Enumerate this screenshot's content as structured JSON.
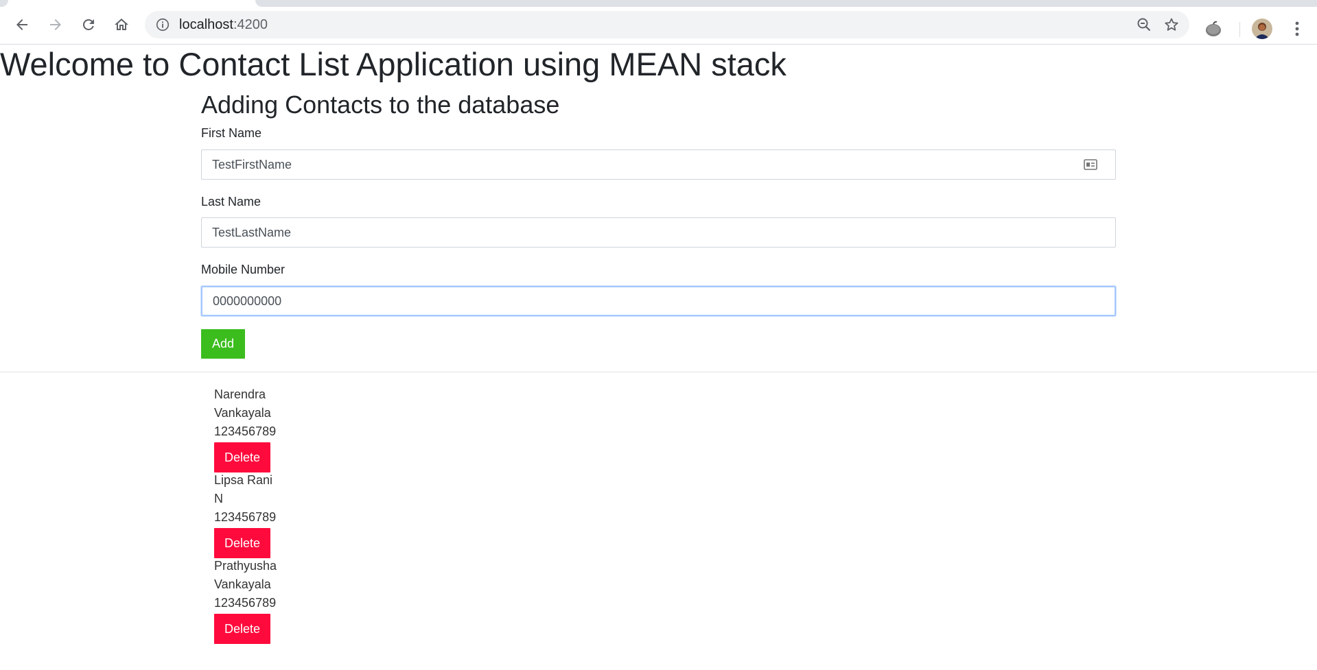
{
  "browser": {
    "url_host": "localhost",
    "url_port": ":4200"
  },
  "page": {
    "title": "Welcome to Contact List Application using MEAN stack"
  },
  "form": {
    "title": "Adding Contacts to the database",
    "first_name": {
      "label": "First Name",
      "value": "TestFirstName"
    },
    "last_name": {
      "label": "Last Name",
      "value": "TestLastName"
    },
    "mobile": {
      "label": "Mobile Number",
      "value": "0000000000"
    },
    "add_label": "Add"
  },
  "contacts": [
    {
      "first": "Narendra",
      "last": "Vankayala",
      "phone": "123456789",
      "delete_label": "Delete"
    },
    {
      "first": "Lipsa Rani",
      "last": "N",
      "phone": "123456789",
      "delete_label": "Delete"
    },
    {
      "first": "Prathyusha",
      "last": "Vankayala",
      "phone": "123456789",
      "delete_label": "Delete"
    }
  ],
  "colors": {
    "add_button": "#3bbd1e",
    "delete_button": "#ff0a3c",
    "focus_ring": "#a6c8ff"
  },
  "icons": {
    "back": "arrow-left-icon",
    "forward": "arrow-right-icon",
    "reload": "reload-icon",
    "home": "home-icon",
    "site_info": "info-icon",
    "zoom": "zoom-out-icon",
    "bookmark": "star-icon",
    "extension": "extension-icon",
    "menu": "kebab-menu-icon",
    "autofill": "contact-card-icon"
  }
}
